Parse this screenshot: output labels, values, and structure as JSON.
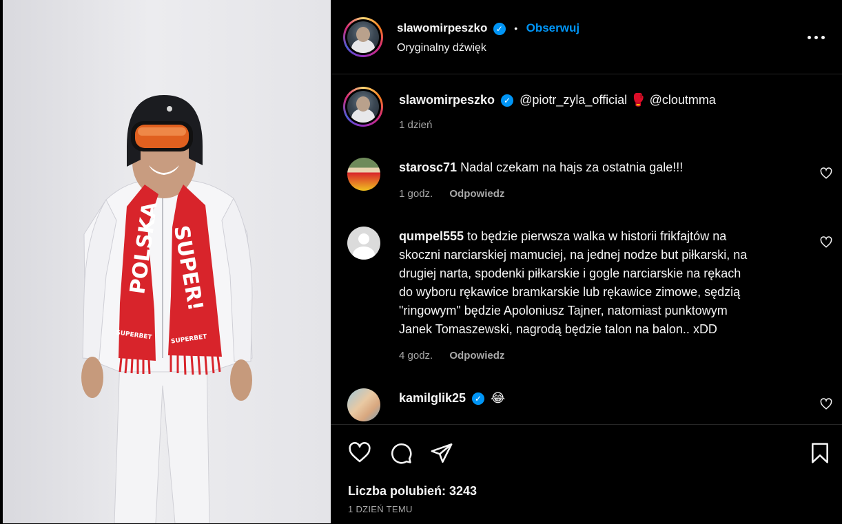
{
  "post": {
    "author": "slawomirpeszko",
    "follow_label": "Obserwuj",
    "audio": "Oryginalny dźwięk",
    "separator": "•"
  },
  "caption": {
    "author": "slawomirpeszko",
    "text_mention1": "@piotr_zyla_official",
    "text_emoji": "🥊",
    "text_mention2": "@cloutmma",
    "time": "1 dzień"
  },
  "comments": [
    {
      "user": "starosc71",
      "text": "Nadal czekam na hajs za ostatnia gale!!!",
      "time": "1 godz.",
      "reply": "Odpowiedz"
    },
    {
      "user": "qumpel555",
      "lines": [
        "to będzie pierwsza walka w historii frikfajtów na",
        "skoczni narciarskiej mamuciej, na jednej nodze but piłkarski, na",
        "drugiej narta, spodenki piłkarskie i gogle narciarskie na rękach",
        "do wyboru rękawice bramkarskie lub rękawice zimowe, sędzią",
        "\"ringowym\" będzie Apoloniusz Tajner, natomiast punktowym",
        "Janek Tomaszewski, nagrodą będzie talon na balon.. xDD"
      ],
      "time": "4 godz.",
      "reply": "Odpowiedz"
    },
    {
      "user": "kamilglik25",
      "text": "😂"
    }
  ],
  "media": {
    "scarf_left_text": "POLSKA",
    "scarf_right_text": "SUPER!",
    "scarf_brand": "SUPERBET"
  },
  "footer": {
    "likes": "Liczba polubień: 3243",
    "date": "1 DZIEŃ TEMU"
  },
  "icons": [
    "heart-icon",
    "comment-icon",
    "share-icon",
    "bookmark-icon",
    "more-icon",
    "verified-icon"
  ],
  "colors": {
    "accent": "#0095f6",
    "background": "#000000",
    "muted": "#a8a8a8",
    "scarf_red": "#d8242b"
  }
}
